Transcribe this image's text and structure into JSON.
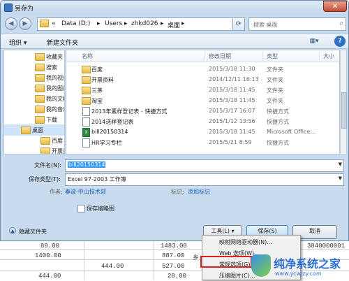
{
  "window": {
    "title": "另存为"
  },
  "address": {
    "path": [
      "«",
      "Data (D:)",
      "Users",
      "zhkd026",
      "桌面"
    ]
  },
  "search": {
    "placeholder": "搜索 桌面"
  },
  "toolbar": {
    "organize": "组织 ▾",
    "new_folder": "新建文件夹"
  },
  "nav": [
    {
      "label": "收藏夹",
      "indent": 1
    },
    {
      "label": "搜索",
      "indent": 1
    },
    {
      "label": "我的视频",
      "indent": 1
    },
    {
      "label": "我的图片",
      "indent": 1
    },
    {
      "label": "我的文档",
      "indent": 1
    },
    {
      "label": "我的音乐",
      "indent": 1
    },
    {
      "label": "下载",
      "indent": 1
    },
    {
      "label": "桌面",
      "indent": 0,
      "selected": true
    },
    {
      "label": "百度",
      "indent": 2
    },
    {
      "label": "开票资料",
      "indent": 2
    }
  ],
  "columns": {
    "name": "名称",
    "date": "修改日期",
    "type": "类型",
    "size": "大小"
  },
  "files": [
    {
      "name": "百度",
      "date": "2015/3/18 11:30",
      "type": "文件夹",
      "icon": "folder"
    },
    {
      "name": "开票资料",
      "date": "2014/12/11 16:13",
      "type": "文件夹",
      "icon": "folder"
    },
    {
      "name": "三茅",
      "date": "2015/3/18 11:45",
      "type": "文件夹",
      "icon": "folder"
    },
    {
      "name": "淘宝",
      "date": "2015/3/18 11:45",
      "type": "文件夹",
      "icon": "folder"
    },
    {
      "name": "2013年素样登记表 - 快捷方式",
      "date": "2015/3/17 16:07",
      "type": "快捷方式",
      "icon": "shortcut"
    },
    {
      "name": "2014送样登记表",
      "date": "2015/1/12 13:56",
      "type": "快捷方式",
      "icon": "shortcut"
    },
    {
      "name": "bill20150314",
      "date": "2015/3/18 11:45",
      "type": "Microsoft Office...",
      "icon": "excel"
    },
    {
      "name": "HR学习专栏",
      "date": "2015/5/21 8:59",
      "type": "快捷方式",
      "icon": "shortcut"
    }
  ],
  "form": {
    "filename_label": "文件名(N):",
    "filename_value": "bill20150314",
    "savetype_label": "保存类型(T):",
    "savetype_value": "Excel 97-2003 工作簿",
    "author_label": "作者:",
    "author_value": "秦波-中山技术部",
    "tags_label": "标记:",
    "tags_value": "添加标记",
    "thumbnail_label": "保存缩略图"
  },
  "bottom": {
    "hide_folders": "隐藏文件夹",
    "tools": "工具(L)",
    "save": "保存(S)",
    "cancel": "取消"
  },
  "menu": [
    {
      "label": "映射网络驱动器(N)..."
    },
    {
      "label": "Web 选项(W)..."
    },
    {
      "label": "常规选项(G)..."
    },
    {
      "label": "压缩图片(C)..."
    }
  ],
  "sheet": {
    "cells": [
      "89.00",
      "1483.00",
      "3840000001",
      "1400.00",
      "887.00",
      "乡",
      "444.00",
      "527.00",
      "444.00",
      "20.00"
    ]
  },
  "watermark": {
    "title": "纯净系统之家",
    "url": "www.ycwjzy.com"
  }
}
